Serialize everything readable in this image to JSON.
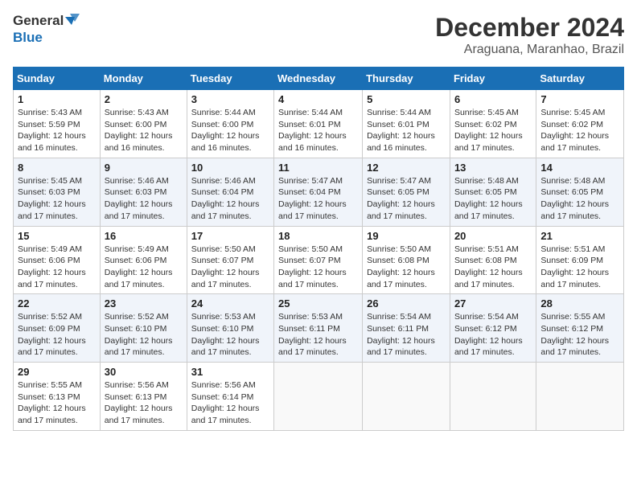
{
  "header": {
    "logo_line1": "General",
    "logo_line2": "Blue",
    "month_year": "December 2024",
    "location": "Araguana, Maranhao, Brazil"
  },
  "days_of_week": [
    "Sunday",
    "Monday",
    "Tuesday",
    "Wednesday",
    "Thursday",
    "Friday",
    "Saturday"
  ],
  "weeks": [
    [
      {
        "day": "1",
        "sunrise": "5:43 AM",
        "sunset": "5:59 PM",
        "daylight": "12 hours and 16 minutes."
      },
      {
        "day": "2",
        "sunrise": "5:43 AM",
        "sunset": "6:00 PM",
        "daylight": "12 hours and 16 minutes."
      },
      {
        "day": "3",
        "sunrise": "5:44 AM",
        "sunset": "6:00 PM",
        "daylight": "12 hours and 16 minutes."
      },
      {
        "day": "4",
        "sunrise": "5:44 AM",
        "sunset": "6:01 PM",
        "daylight": "12 hours and 16 minutes."
      },
      {
        "day": "5",
        "sunrise": "5:44 AM",
        "sunset": "6:01 PM",
        "daylight": "12 hours and 16 minutes."
      },
      {
        "day": "6",
        "sunrise": "5:45 AM",
        "sunset": "6:02 PM",
        "daylight": "12 hours and 17 minutes."
      },
      {
        "day": "7",
        "sunrise": "5:45 AM",
        "sunset": "6:02 PM",
        "daylight": "12 hours and 17 minutes."
      }
    ],
    [
      {
        "day": "8",
        "sunrise": "5:45 AM",
        "sunset": "6:03 PM",
        "daylight": "12 hours and 17 minutes."
      },
      {
        "day": "9",
        "sunrise": "5:46 AM",
        "sunset": "6:03 PM",
        "daylight": "12 hours and 17 minutes."
      },
      {
        "day": "10",
        "sunrise": "5:46 AM",
        "sunset": "6:04 PM",
        "daylight": "12 hours and 17 minutes."
      },
      {
        "day": "11",
        "sunrise": "5:47 AM",
        "sunset": "6:04 PM",
        "daylight": "12 hours and 17 minutes."
      },
      {
        "day": "12",
        "sunrise": "5:47 AM",
        "sunset": "6:05 PM",
        "daylight": "12 hours and 17 minutes."
      },
      {
        "day": "13",
        "sunrise": "5:48 AM",
        "sunset": "6:05 PM",
        "daylight": "12 hours and 17 minutes."
      },
      {
        "day": "14",
        "sunrise": "5:48 AM",
        "sunset": "6:05 PM",
        "daylight": "12 hours and 17 minutes."
      }
    ],
    [
      {
        "day": "15",
        "sunrise": "5:49 AM",
        "sunset": "6:06 PM",
        "daylight": "12 hours and 17 minutes."
      },
      {
        "day": "16",
        "sunrise": "5:49 AM",
        "sunset": "6:06 PM",
        "daylight": "12 hours and 17 minutes."
      },
      {
        "day": "17",
        "sunrise": "5:50 AM",
        "sunset": "6:07 PM",
        "daylight": "12 hours and 17 minutes."
      },
      {
        "day": "18",
        "sunrise": "5:50 AM",
        "sunset": "6:07 PM",
        "daylight": "12 hours and 17 minutes."
      },
      {
        "day": "19",
        "sunrise": "5:50 AM",
        "sunset": "6:08 PM",
        "daylight": "12 hours and 17 minutes."
      },
      {
        "day": "20",
        "sunrise": "5:51 AM",
        "sunset": "6:08 PM",
        "daylight": "12 hours and 17 minutes."
      },
      {
        "day": "21",
        "sunrise": "5:51 AM",
        "sunset": "6:09 PM",
        "daylight": "12 hours and 17 minutes."
      }
    ],
    [
      {
        "day": "22",
        "sunrise": "5:52 AM",
        "sunset": "6:09 PM",
        "daylight": "12 hours and 17 minutes."
      },
      {
        "day": "23",
        "sunrise": "5:52 AM",
        "sunset": "6:10 PM",
        "daylight": "12 hours and 17 minutes."
      },
      {
        "day": "24",
        "sunrise": "5:53 AM",
        "sunset": "6:10 PM",
        "daylight": "12 hours and 17 minutes."
      },
      {
        "day": "25",
        "sunrise": "5:53 AM",
        "sunset": "6:11 PM",
        "daylight": "12 hours and 17 minutes."
      },
      {
        "day": "26",
        "sunrise": "5:54 AM",
        "sunset": "6:11 PM",
        "daylight": "12 hours and 17 minutes."
      },
      {
        "day": "27",
        "sunrise": "5:54 AM",
        "sunset": "6:12 PM",
        "daylight": "12 hours and 17 minutes."
      },
      {
        "day": "28",
        "sunrise": "5:55 AM",
        "sunset": "6:12 PM",
        "daylight": "12 hours and 17 minutes."
      }
    ],
    [
      {
        "day": "29",
        "sunrise": "5:55 AM",
        "sunset": "6:13 PM",
        "daylight": "12 hours and 17 minutes."
      },
      {
        "day": "30",
        "sunrise": "5:56 AM",
        "sunset": "6:13 PM",
        "daylight": "12 hours and 17 minutes."
      },
      {
        "day": "31",
        "sunrise": "5:56 AM",
        "sunset": "6:14 PM",
        "daylight": "12 hours and 17 minutes."
      },
      null,
      null,
      null,
      null
    ]
  ],
  "labels": {
    "sunrise": "Sunrise:",
    "sunset": "Sunset:",
    "daylight": "Daylight:"
  }
}
